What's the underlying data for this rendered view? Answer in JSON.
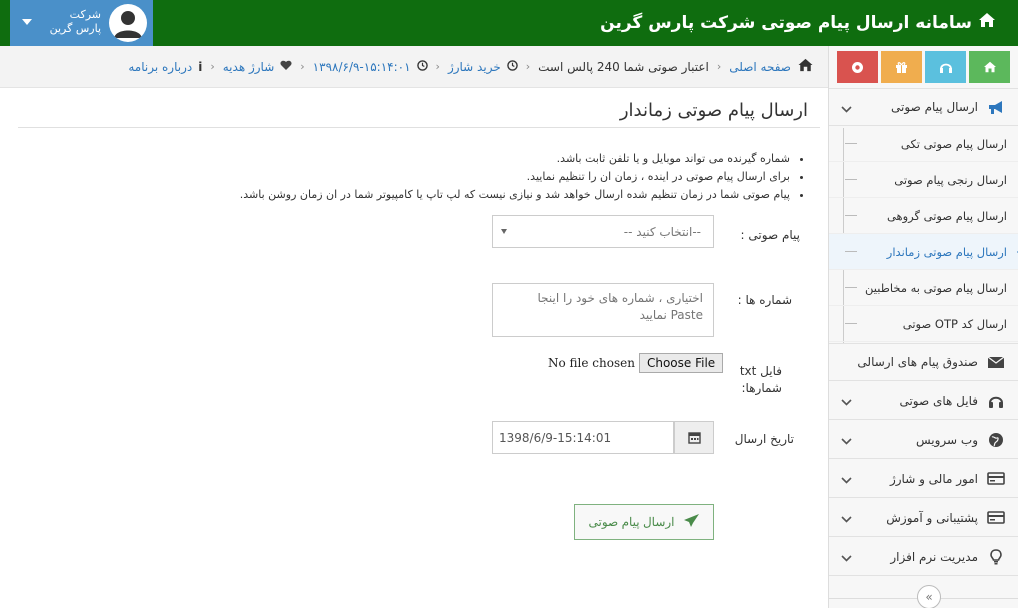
{
  "header": {
    "title": "سامانه ارسال پیام صوتی شرکت پارس گرین",
    "user_line1": "شرکت",
    "user_line2": "پارس گرین"
  },
  "breadcrumb": {
    "home": "صفحه اصلی",
    "credit": "اعتبار صوتی شما 240 پالس است",
    "buy": "خرید شارژ",
    "datetime": "۱۳۹۸/۶/۹-۱۵:۱۴:۰۱",
    "gift": "شارژ هدیه",
    "about": "درباره برنامه"
  },
  "sidebar": {
    "shortcut_colors": [
      "#5cb85c",
      "#5bc0de",
      "#f0ad4e",
      "#d9534f"
    ],
    "main_item": "ارسال پیام صوتی",
    "subitems": [
      "ارسال پیام صوتی تکی",
      "ارسال رنجی پیام صوتی",
      "ارسال پیام صوتی گروهی",
      "ارسال پیام صوتی زماندار",
      "ارسال پیام صوتی به مخاطبین",
      "ارسال کد OTP صوتی"
    ],
    "active_index": 3,
    "items": [
      "صندوق پیام های ارسالی",
      "فایل های صوتی",
      "وب سرویس",
      "امور مالی و شارژ",
      "پشتیبانی و آموزش",
      "مدیریت نرم افزار"
    ],
    "collapse_icon": "«"
  },
  "main": {
    "title": "ارسال پیام صوتی زماندار",
    "notes": [
      "شماره گیرنده می تواند موبایل و یا تلفن ثابت باشد.",
      "برای ارسال پیام صوتی در اینده ، زمان ان را تنظیم نمایید.",
      "پیام صوتی شما در زمان تنظیم شده ارسال خواهد شد و نیازی نیست که لپ تاپ یا کامپیوتر شما در ان زمان روشن باشد."
    ],
    "voice_label": "پیام صوتی :",
    "voice_select": "--انتخاب کنید --",
    "numbers_label": "شماره ها :",
    "numbers_placeholder": "اختیاری ، شماره های خود را اینجا Paste نمایید",
    "file_label": "فایل txt شمارها:",
    "file_button": "Choose File",
    "file_status": "No file chosen",
    "date_label": "تاریخ ارسال",
    "date_value": "1398/6/9-15:14:01",
    "send_button": "ارسال پیام صوتی"
  }
}
